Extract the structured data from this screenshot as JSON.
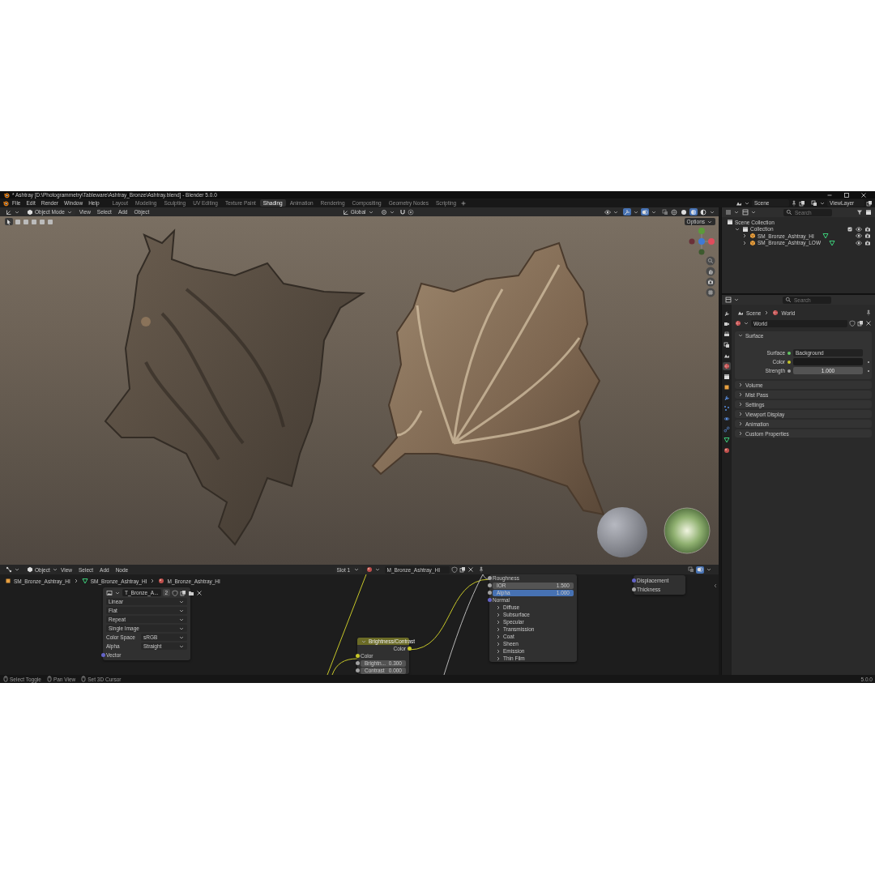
{
  "window": {
    "title": "* Ashtray [D:\\Photogrammetry\\Tableware\\Ashtray_Bronze\\Ashtray.blend] - Blender 5.0.0"
  },
  "menu": [
    "File",
    "Edit",
    "Render",
    "Window",
    "Help"
  ],
  "workspaces": [
    {
      "label": "Layout",
      "selected": false
    },
    {
      "label": "Modeling",
      "selected": false
    },
    {
      "label": "Sculpting",
      "selected": false
    },
    {
      "label": "UV Editing",
      "selected": false
    },
    {
      "label": "Texture Paint",
      "selected": false
    },
    {
      "label": "Shading",
      "selected": true
    },
    {
      "label": "Animation",
      "selected": false
    },
    {
      "label": "Rendering",
      "selected": false
    },
    {
      "label": "Compositing",
      "selected": false
    },
    {
      "label": "Geometry Nodes",
      "selected": false
    },
    {
      "label": "Scripting",
      "selected": false
    }
  ],
  "scene": {
    "name": "Scene"
  },
  "view_layer": {
    "name": "ViewLayer"
  },
  "viewport": {
    "mode": "Object Mode",
    "menu": [
      "View",
      "Select",
      "Add",
      "Object"
    ],
    "orientation": "Global",
    "options": "Options",
    "shading_modes": [
      {
        "kind": "wireframe",
        "selected": false
      },
      {
        "kind": "solid",
        "selected": false
      },
      {
        "kind": "material",
        "selected": true
      },
      {
        "kind": "rendered",
        "selected": false
      }
    ]
  },
  "outliner": {
    "search": {
      "placeholder": "Search"
    },
    "tree": [
      {
        "label": "Scene Collection",
        "kind": "scene_collection",
        "children": [
          {
            "label": "Collection",
            "kind": "collection",
            "expanded": true,
            "children": [
              {
                "label": "SM_Bronze_Ashtray_HI",
                "kind": "mesh",
                "expanded": false
              },
              {
                "label": "SM_Bronze_Ashtray_LOW",
                "kind": "mesh",
                "expanded": false
              }
            ]
          }
        ]
      }
    ]
  },
  "properties": {
    "search": {
      "placeholder": "Search"
    },
    "tabs": [
      {
        "kind": "tool",
        "selected": false
      },
      {
        "kind": "render",
        "selected": false
      },
      {
        "kind": "output",
        "selected": false
      },
      {
        "kind": "view_layer",
        "selected": false
      },
      {
        "kind": "scene",
        "selected": false
      },
      {
        "kind": "world",
        "selected": true
      },
      {
        "kind": "collection",
        "selected": false
      },
      {
        "kind": "object",
        "selected": false
      },
      {
        "kind": "modifier",
        "selected": false
      },
      {
        "kind": "particles",
        "selected": false
      },
      {
        "kind": "physics",
        "selected": false
      },
      {
        "kind": "constraints",
        "selected": false
      },
      {
        "kind": "data",
        "selected": false
      },
      {
        "kind": "material",
        "selected": false
      }
    ],
    "breadcrumb": [
      {
        "label": "Scene",
        "kind": "scene"
      },
      {
        "label": "World",
        "kind": "world"
      }
    ],
    "world": "World",
    "panels": [
      {
        "label": "Surface",
        "expanded": true,
        "fields": [
          {
            "kind": "shader",
            "label": "Surface",
            "value": "Background",
            "color": "#63c763"
          },
          {
            "kind": "color",
            "label": "Color",
            "color": "#c7c729"
          },
          {
            "kind": "number",
            "label": "Strength",
            "value": "1.000",
            "color": "#a1a1a1"
          }
        ]
      },
      {
        "label": "Volume",
        "expanded": false
      },
      {
        "label": "Mist Pass",
        "expanded": false
      },
      {
        "label": "Settings",
        "expanded": false
      },
      {
        "label": "Viewport Display",
        "expanded": false
      },
      {
        "label": "Animation",
        "expanded": false
      },
      {
        "label": "Custom Properties",
        "expanded": false
      }
    ]
  },
  "node_editor": {
    "type": "Object",
    "menu": [
      "View",
      "Select",
      "Add",
      "Node"
    ],
    "slot": "Slot 1",
    "material": "M_Bronze_Ashtray_HI",
    "breadcrumb": [
      {
        "label": "SM_Bronze_Ashtray_HI",
        "kind": "object"
      },
      {
        "label": "SM_Bronze_Ashtray_HI",
        "kind": "mesh"
      },
      {
        "label": "M_Bronze_Ashtray_HI",
        "kind": "material"
      }
    ],
    "nodes": [
      {
        "kind": "image_texture",
        "title": "T_Bronze_A...",
        "users": "2",
        "rows": [
          {
            "kind": "dropdown",
            "value": "Linear"
          },
          {
            "kind": "dropdown",
            "value": "Flat"
          },
          {
            "kind": "dropdown",
            "value": "Repeat"
          },
          {
            "kind": "dropdown",
            "value": "Single Image"
          },
          {
            "kind": "labeled_dropdown",
            "label": "Color Space",
            "value": "sRGB"
          },
          {
            "kind": "labeled_dropdown",
            "label": "Alpha",
            "value": "Straight"
          },
          {
            "kind": "input",
            "label": "Vector",
            "color": "#6363c7"
          }
        ]
      },
      {
        "kind": "brightness_contrast",
        "title": "Brightness/Contrast",
        "rows": [
          {
            "kind": "output",
            "label": "Color",
            "color": "#c7c729"
          },
          {
            "kind": "input",
            "label": "Color",
            "color": "#c7c729"
          },
          {
            "kind": "value",
            "label": "Brightn...",
            "value": "0.300",
            "color": "#a1a1a1",
            "selected": false
          },
          {
            "kind": "value",
            "label": "Contrast",
            "value": "0.000",
            "color": "#a1a1a1",
            "selected": false
          }
        ]
      },
      {
        "kind": "principled_bsdf",
        "rows": [
          {
            "kind": "input",
            "label": "Roughness",
            "color": "#a1a1a1"
          },
          {
            "kind": "value",
            "label": "IOR",
            "value": "1.500",
            "color": "#a1a1a1",
            "selected": false
          },
          {
            "kind": "value",
            "label": "Alpha",
            "value": "1.000",
            "color": "#a1a1a1",
            "selected": true
          },
          {
            "kind": "input",
            "label": "Normal",
            "color": "#6363c7"
          },
          {
            "kind": "panel",
            "label": "Diffuse",
            "expanded": false
          },
          {
            "kind": "panel",
            "label": "Subsurface",
            "expanded": false
          },
          {
            "kind": "panel",
            "label": "Specular",
            "expanded": false
          },
          {
            "kind": "panel",
            "label": "Transmission",
            "expanded": false
          },
          {
            "kind": "panel",
            "label": "Coat",
            "expanded": false
          },
          {
            "kind": "panel",
            "label": "Sheen",
            "expanded": false
          },
          {
            "kind": "panel",
            "label": "Emission",
            "expanded": false
          },
          {
            "kind": "panel",
            "label": "Thin Film",
            "expanded": false
          }
        ]
      },
      {
        "kind": "material_output",
        "rows": [
          {
            "kind": "input",
            "label": "Displacement",
            "color": "#6363c7"
          },
          {
            "kind": "input",
            "label": "Thickness",
            "color": "#a1a1a1"
          }
        ]
      }
    ]
  },
  "status_bar": {
    "hints": [
      "Select Toggle",
      "Pan View",
      "Set 3D Cursor"
    ],
    "version": "5.0.0"
  }
}
